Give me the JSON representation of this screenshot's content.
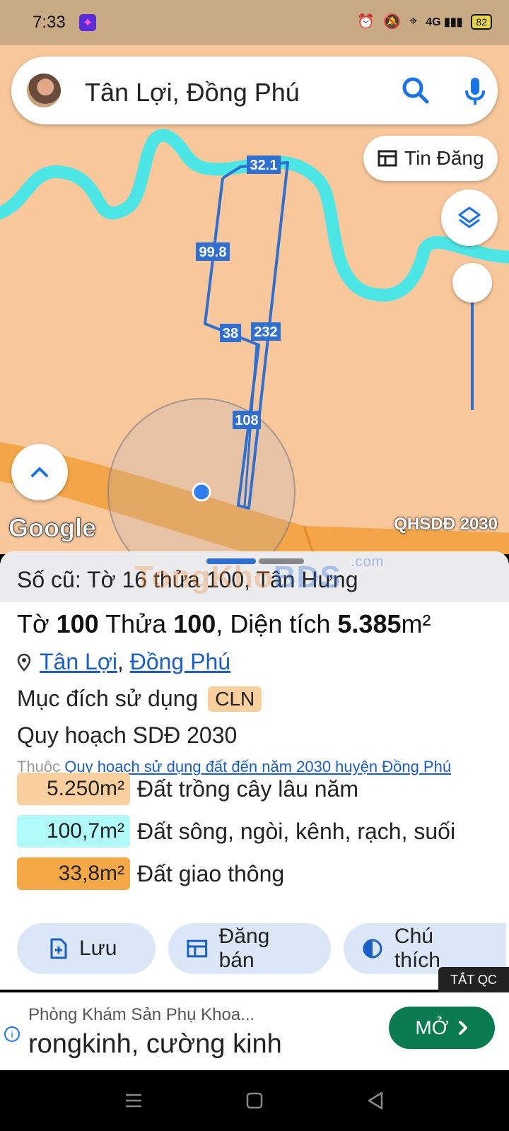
{
  "status_bar": {
    "time": "7:33",
    "battery": "82"
  },
  "search": {
    "query": "Tân Lợi, Đồng Phú"
  },
  "map": {
    "tin_dang_label": "Tin Đăng",
    "parcel_edges": [
      "32.1",
      "99.8",
      "38",
      "232",
      "108"
    ],
    "google_label": "Google",
    "layer_label": "QHSDĐ 2030",
    "colors": {
      "land": "#f8c79b",
      "river": "#4de6e6",
      "road": "#f4a547",
      "parcel": "#2f6fd0"
    }
  },
  "sheet": {
    "old_number": "Số cũ: Tờ 16 thửa 100, Tân Hưng",
    "watermark": {
      "tongkho": "TongKho",
      "bds": "BDS",
      "com": ".com"
    },
    "parcel": {
      "sheet_label": "Tờ",
      "sheet_no": "100",
      "plot_label": "Thửa",
      "plot_no": "100",
      "area_label": "Diện tích",
      "area_value": "5.385",
      "area_unit": "m²"
    },
    "location": {
      "ward": "Tân Lợi",
      "separator": ",",
      "district": "Đồng Phú"
    },
    "purpose": {
      "label": "Mục đích sử dụng",
      "code": "CLN"
    },
    "plan": {
      "title": "Quy hoạch SDĐ 2030",
      "ref_prefix": "Thuộc",
      "ref_link": "Quy hoạch sử dụng đất đến năm 2030 huyện Đồng Phú"
    },
    "uses": [
      {
        "area": "5.250m²",
        "desc": "Đất trồng cây lâu năm",
        "color": "#f9cf9d"
      },
      {
        "area": "100,7m²",
        "desc": "Đất sông, ngòi, kênh, rạch, suối",
        "color": "#b2fbfb"
      },
      {
        "area": "33,8m²",
        "desc": "Đất giao thông",
        "color": "#f5a946"
      }
    ],
    "actions": {
      "save": "Lưu",
      "post_sale": "Đăng bán",
      "legend": "Chú thích"
    }
  },
  "ad": {
    "close_label": "TẮT QC",
    "title": "Phòng Khám Sản Phụ Khoa...",
    "body": "rongkinh, cường kinh",
    "open_label": "MỞ"
  }
}
